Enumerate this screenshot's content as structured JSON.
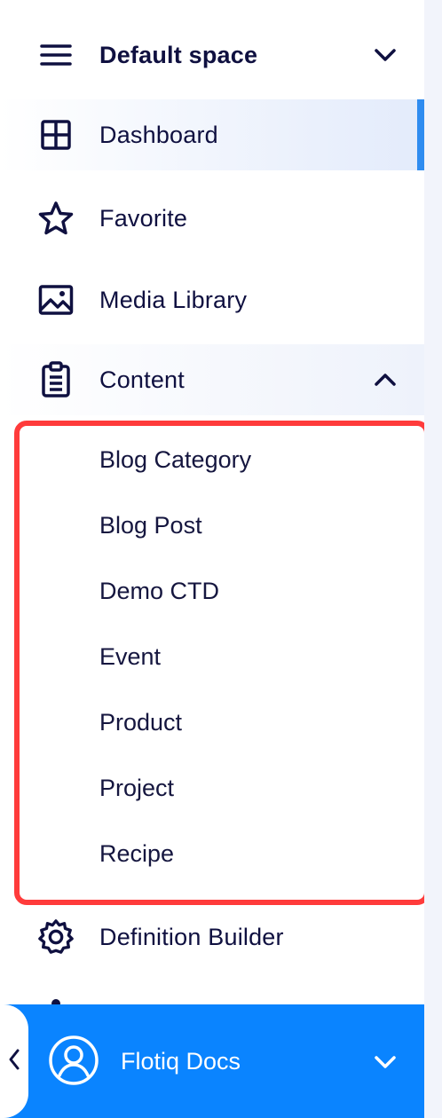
{
  "header": {
    "space_name": "Default space"
  },
  "nav": {
    "dashboard": "Dashboard",
    "favorite": "Favorite",
    "media_library": "Media Library",
    "content": "Content",
    "definition_builder": "Definition Builder"
  },
  "content_types": [
    "Blog Category",
    "Blog Post",
    "Demo CTD",
    "Event",
    "Product",
    "Project",
    "Recipe"
  ],
  "account": {
    "name": "Flotiq Docs"
  },
  "colors": {
    "accent": "#0a84ff",
    "active_indicator": "#2f8cf0",
    "highlight_border": "#ff3b3b",
    "text": "#0f1040"
  },
  "icons": {
    "space": "hamburger-icon",
    "dashboard": "grid-icon",
    "favorite": "star-icon",
    "media": "image-icon",
    "content": "clipboard-icon",
    "definition_builder": "gear-icon",
    "account": "user-circle-icon"
  }
}
